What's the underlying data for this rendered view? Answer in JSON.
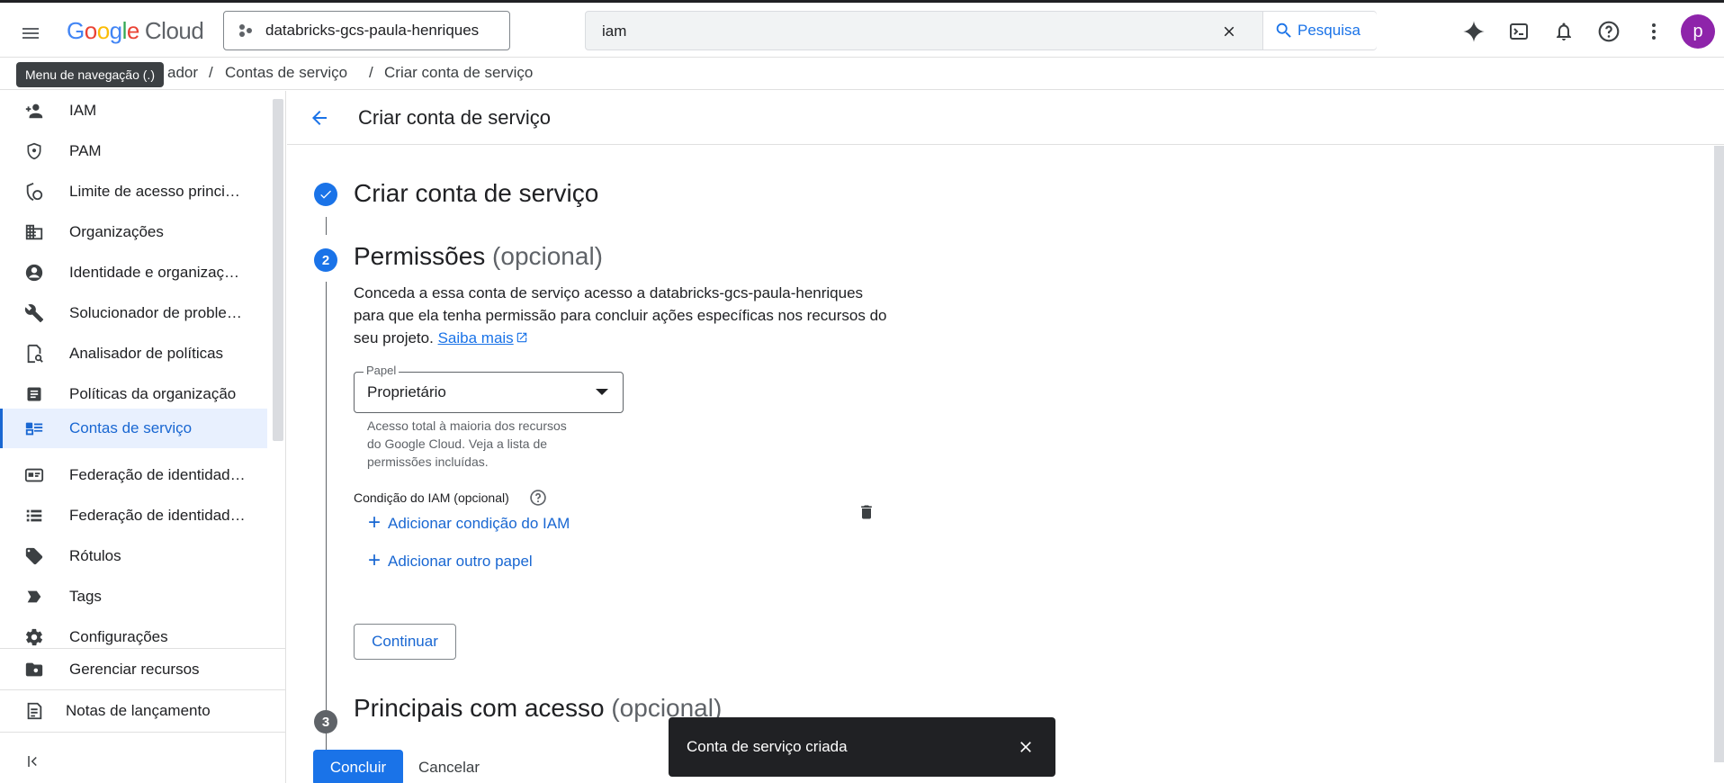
{
  "topbar": {
    "menu_tooltip": "Menu de navegação (.)",
    "logo": {
      "g1": "G",
      "g2": "o",
      "g3": "o",
      "g4": "g",
      "g5": "l",
      "g6": "e",
      "cloud": "Cloud"
    },
    "project_name": "databricks-gcs-paula-henriques",
    "search_value": "iam",
    "search_button": "Pesquisa",
    "avatar_letter": "p"
  },
  "breadcrumb": {
    "first": "ador",
    "sep1": "/",
    "second": "Contas de serviço",
    "sep2": "/",
    "third": "Criar conta de serviço"
  },
  "sidebar": {
    "items": [
      {
        "label": "IAM",
        "icon": "person-add-icon"
      },
      {
        "label": "PAM",
        "icon": "shield-icon"
      },
      {
        "label": "Limite de acesso princi…",
        "icon": "boundary-icon"
      },
      {
        "label": "Organizações",
        "icon": "organization-icon"
      },
      {
        "label": "Identidade e organizaç…",
        "icon": "account-circle-icon"
      },
      {
        "label": "Solucionador de proble…",
        "icon": "wrench-icon"
      },
      {
        "label": "Analisador de políticas",
        "icon": "policy-analyzer-icon"
      },
      {
        "label": "Políticas da organização",
        "icon": "document-icon"
      },
      {
        "label": "Contas de serviço",
        "icon": "service-account-icon",
        "active": true
      },
      {
        "label": "Federação de identidad…",
        "icon": "id-card-icon"
      },
      {
        "label": "Federação de identidad…",
        "icon": "list-icon"
      },
      {
        "label": "Rótulos",
        "icon": "label-icon"
      },
      {
        "label": "Tags",
        "icon": "tag-icon"
      },
      {
        "label": "Configurações",
        "icon": "gear-icon"
      }
    ],
    "manage_resources": "Gerenciar recursos",
    "release_notes": "Notas de lançamento"
  },
  "main": {
    "header_title": "Criar conta de serviço",
    "step1": {
      "title": "Criar conta de serviço"
    },
    "step2": {
      "number": "2",
      "title": "Permissões",
      "optional": "(opcional)",
      "description": "Conceda a essa conta de serviço acesso a databricks-gcs-paula-henriques para que ela tenha permissão para concluir ações específicas nos recursos do seu projeto.",
      "learn_more": "Saiba mais",
      "role_label": "Papel",
      "role_value": "Proprietário",
      "role_hint": "Acesso total à maioria dos recursos do Google Cloud. Veja a lista de permissões incluídas.",
      "condition_label": "Condição do IAM (opcional)",
      "add_condition": "Adicionar condição do IAM",
      "add_role": "Adicionar outro papel",
      "continue": "Continuar"
    },
    "step3": {
      "number": "3",
      "title": "Principais com acesso",
      "optional": "(opcional)"
    },
    "done": "Concluir",
    "cancel": "Cancelar"
  },
  "snackbar": {
    "message": "Conta de serviço criada"
  },
  "colors": {
    "accent": "#1a73e8",
    "active_bg": "#e8f0fe",
    "snackbar": "#202124"
  }
}
